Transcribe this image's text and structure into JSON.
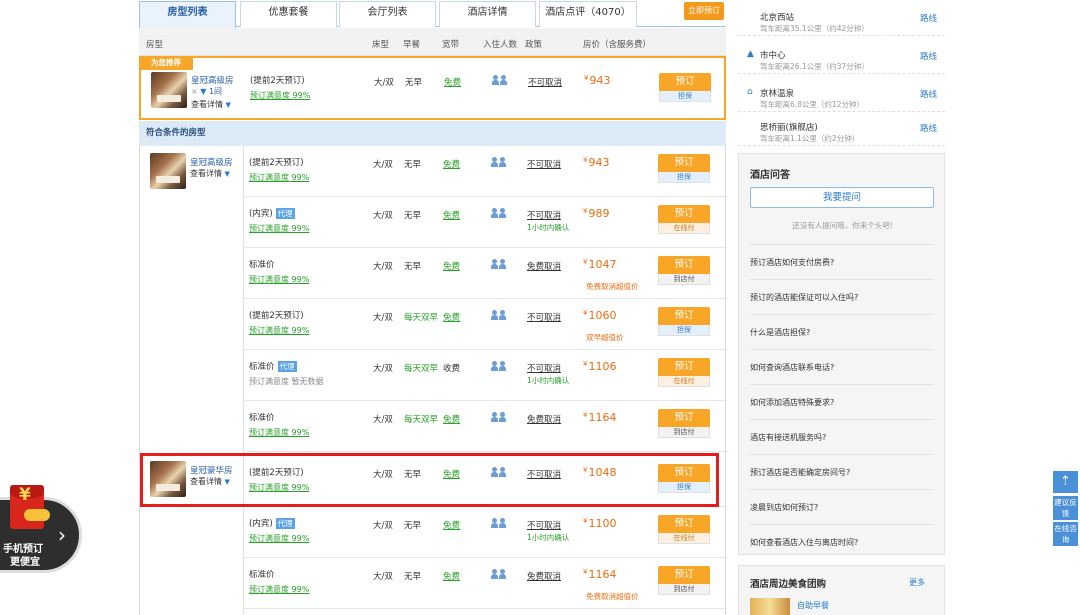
{
  "tabs": [
    {
      "label": "房型列表"
    },
    {
      "label": "优惠套餐"
    },
    {
      "label": "会厅列表"
    },
    {
      "label": "酒店详情"
    },
    {
      "label": "酒店点评（4070）"
    }
  ],
  "book_now_label": "立即预订",
  "table_header": {
    "room_type": "房型",
    "bed": "床型",
    "breakfast": "早餐",
    "network": "宽带",
    "occupancy": "入住人数",
    "policy": "政策",
    "price": "房价（含服务费）"
  },
  "recommended": {
    "badge": "为您推荐",
    "room_name": "皇冠高级房",
    "qty_prefix": "×",
    "qty": "1间",
    "detail_link": "查看详情",
    "row": {
      "name": "(提前2天预订)",
      "sat": "预订满意度 99%",
      "bed": "大/双",
      "breakfast": "无早",
      "net": "免费",
      "policy": "不可取消",
      "currency": "¥",
      "price": "943",
      "book": "预订",
      "sub": "担保"
    }
  },
  "section_label": "符合条件的房型",
  "rooms": [
    {
      "name": "皇冠高级房",
      "detail": "查看详情"
    },
    {
      "name": "皇冠豪华房",
      "detail": "查看详情"
    }
  ],
  "rows": [
    {
      "name": "(提前2天预订)",
      "tag": "",
      "sat": "预订满意度 99%",
      "bed": "大/双",
      "breakfast": "无早",
      "net": "免费",
      "policy": "不可取消",
      "policy_note": "",
      "currency": "¥",
      "price": "943",
      "price_note": "",
      "book": "预订",
      "sub": "担保"
    },
    {
      "name": "(内宾)",
      "tag": "代理",
      "sat": "预订满意度 99%",
      "bed": "大/双",
      "breakfast": "无早",
      "net": "免费",
      "policy": "不可取消",
      "policy_note": "1小时内确认",
      "currency": "¥",
      "price": "989",
      "price_note": "",
      "book": "预订",
      "sub": "在线付"
    },
    {
      "name": "标准价",
      "tag": "",
      "sat": "预订满意度 99%",
      "bed": "大/双",
      "breakfast": "无早",
      "net": "免费",
      "policy": "免费取消",
      "policy_note": "",
      "currency": "¥",
      "price": "1047",
      "price_note": "免费取消超值价",
      "book": "预订",
      "sub": "到店付"
    },
    {
      "name": "(提前2天预订)",
      "tag": "",
      "sat": "预订满意度 99%",
      "bed": "大/双",
      "breakfast": "每天双早",
      "net": "免费",
      "policy": "不可取消",
      "policy_note": "",
      "currency": "¥",
      "price": "1060",
      "price_note": "双早超值价",
      "book": "预订",
      "sub": "担保"
    },
    {
      "name": "标准价",
      "tag": "代理",
      "sat": "预订满意度 暂无数据",
      "bed": "大/双",
      "breakfast": "每天双早",
      "net": "收费",
      "policy": "不可取消",
      "policy_note": "1小时内确认",
      "currency": "¥",
      "price": "1106",
      "price_note": "",
      "book": "预订",
      "sub": "在线付"
    },
    {
      "name": "标准价",
      "tag": "",
      "sat": "预订满意度 99%",
      "bed": "大/双",
      "breakfast": "每天双早",
      "net": "免费",
      "policy": "免费取消",
      "policy_note": "",
      "currency": "¥",
      "price": "1164",
      "price_note": "",
      "book": "预订",
      "sub": "到店付"
    },
    {
      "name": "(提前2天预订)",
      "tag": "",
      "sat": "预订满意度 99%",
      "bed": "大/双",
      "breakfast": "无早",
      "net": "免费",
      "policy": "不可取消",
      "policy_note": "",
      "currency": "¥",
      "price": "1048",
      "price_note": "",
      "book": "预订",
      "sub": "担保"
    },
    {
      "name": "(内宾)",
      "tag": "代理",
      "sat": "预订满意度 99%",
      "bed": "大/双",
      "breakfast": "无早",
      "net": "免费",
      "policy": "不可取消",
      "policy_note": "1小时内确认",
      "currency": "¥",
      "price": "1100",
      "price_note": "",
      "book": "预订",
      "sub": "在线付"
    },
    {
      "name": "标准价",
      "tag": "",
      "sat": "预订满意度 99%",
      "bed": "大/双",
      "breakfast": "无早",
      "net": "免费",
      "policy": "免费取消",
      "policy_note": "",
      "currency": "¥",
      "price": "1164",
      "price_note": "免费取消超值价",
      "book": "预订",
      "sub": "到店付"
    }
  ],
  "stations": [
    {
      "name": "北京西站",
      "dist": "驾车距离35.1公里（约42分钟）",
      "link": "路线",
      "icon": ""
    },
    {
      "name": "市中心",
      "dist": "驾车距离26.1公里（约37分钟）",
      "link": "路线",
      "icon": "building-icon"
    },
    {
      "name": "京林温泉",
      "dist": "驾车距离6.8公里（约12分钟）",
      "link": "路线",
      "icon": "landmark-icon"
    },
    {
      "name": "思桥丽(旗舰店)",
      "dist": "驾车距离1.1公里（约2分钟）",
      "link": "路线",
      "icon": ""
    }
  ],
  "qa": {
    "title": "酒店问答",
    "ask": "我要提问",
    "none": "还没有人提问哦，你来个头吧!",
    "items": [
      "预订酒店如何支付房费?",
      "预订的酒店能保证可以入住吗?",
      "什么是酒店担保?",
      "如何查询酒店联系电话?",
      "如何添加酒店特殊要求?",
      "酒店有接送机服务吗?",
      "预订酒店是否能确定房间号?",
      "凌晨到店如何预订?",
      "如何查看酒店入住与离店时间?"
    ]
  },
  "food": {
    "title": "酒店周边美食团购",
    "more": "更多",
    "item": "自助早餐"
  },
  "promo": {
    "line1": "手机预订",
    "line2": "更便宜",
    "yen": "¥"
  },
  "float": {
    "feedback": "建议反馈",
    "consult": "在线咨询"
  },
  "colors": {
    "accent_orange": "#f7a628",
    "price_orange": "#f06a0f",
    "link_blue": "#2a7bd0",
    "highlight_red": "#e61c1c",
    "green": "#27a227"
  }
}
